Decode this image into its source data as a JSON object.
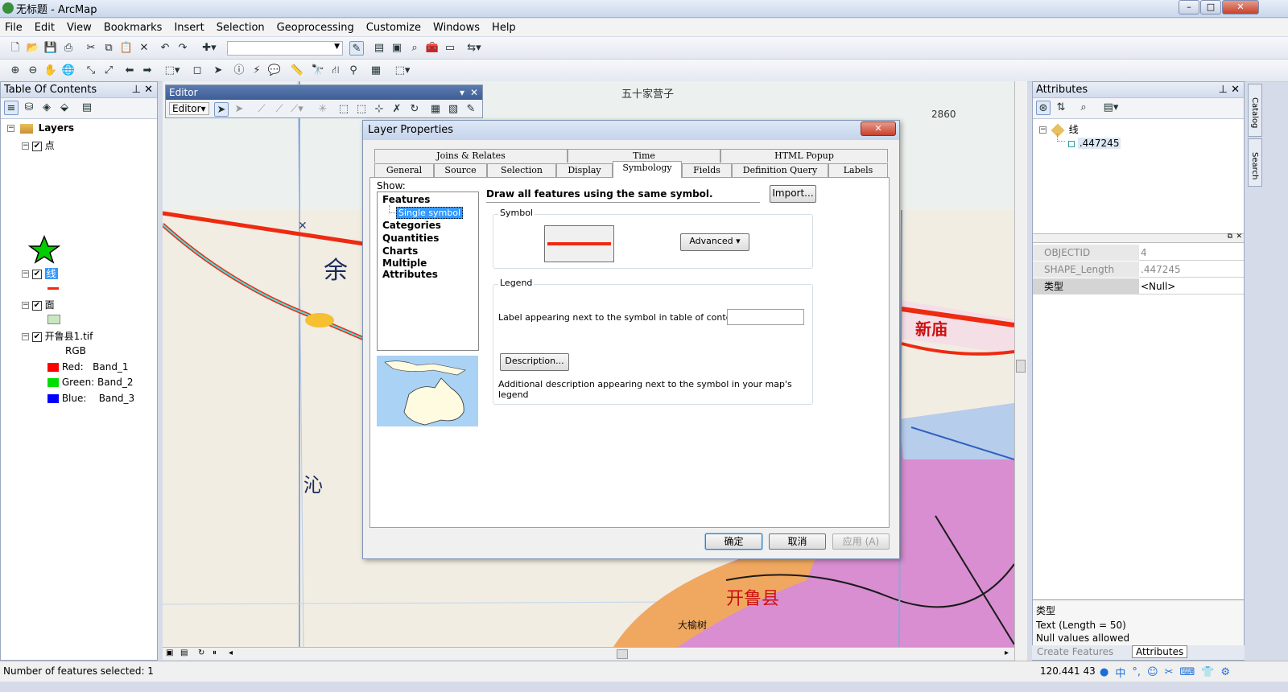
{
  "window": {
    "title": "无标题 - ArcMap"
  },
  "menu": [
    "File",
    "Edit",
    "View",
    "Bookmarks",
    "Insert",
    "Selection",
    "Geoprocessing",
    "Customize",
    "Windows",
    "Help"
  ],
  "toc": {
    "title": "Table Of Contents",
    "root": "Layers",
    "layers": [
      {
        "name": "点"
      },
      {
        "name": "线"
      },
      {
        "name": "面"
      },
      {
        "name": "开鲁县1.tif",
        "sub": "RGB",
        "bands": [
          {
            "ch": "Red:",
            "band": "Band_1",
            "color": "#ff0000"
          },
          {
            "ch": "Green:",
            "band": "Band_2",
            "color": "#00dd00"
          },
          {
            "ch": "Blue:",
            "band": "Band_3",
            "color": "#0000ff"
          }
        ]
      }
    ]
  },
  "editor": {
    "title": "Editor",
    "menu": "Editor▾"
  },
  "dialog": {
    "title": "Layer Properties",
    "tabs_top": [
      "Joins & Relates",
      "Time",
      "HTML Popup"
    ],
    "tabs_bottom": [
      "General",
      "Source",
      "Selection",
      "Display",
      "Symbology",
      "Fields",
      "Definition Query",
      "Labels"
    ],
    "active_tab": "Symbology",
    "show_label": "Show:",
    "show_tree": {
      "features": "Features",
      "single": "Single symbol",
      "others": [
        "Categories",
        "Quantities",
        "Charts",
        "Multiple Attributes"
      ]
    },
    "heading": "Draw all features using the same symbol.",
    "import": "Import...",
    "symbol_legend": "Symbol",
    "advanced": "Advanced",
    "legend_legend": "Legend",
    "legend_label": "Label appearing next to the symbol in table of contents:",
    "label_value": "",
    "description_btn": "Description...",
    "description_text": "Additional description appearing next to the symbol in your map's legend",
    "ok": "确定",
    "cancel": "取消",
    "apply": "应用 (A)"
  },
  "attributes": {
    "title": "Attributes",
    "tree_layer": "线",
    "tree_feature": ".447245",
    "fields": [
      {
        "name": "OBJECTID",
        "value": "4"
      },
      {
        "name": "SHAPE_Length",
        "value": ".447245"
      },
      {
        "name": "类型",
        "value": "<Null>"
      }
    ],
    "info_title": "类型",
    "info_lines": [
      "Text (Length = 50)",
      "Null values allowed"
    ],
    "bottom_tabs": [
      "Create Features",
      "Attributes"
    ]
  },
  "side_tabs": [
    "Catalog",
    "Search"
  ],
  "map_labels": [
    "五十家营子",
    "沁",
    "余",
    "2860",
    "新庙",
    "开鲁县",
    "大榆树"
  ],
  "status": {
    "left": "Number of features selected: 1",
    "coords": "120.441  43"
  },
  "colors": {
    "line_symbol": "#ee2a10",
    "selection": "#3399ff",
    "polygon_fill": "#c8e8c0"
  }
}
